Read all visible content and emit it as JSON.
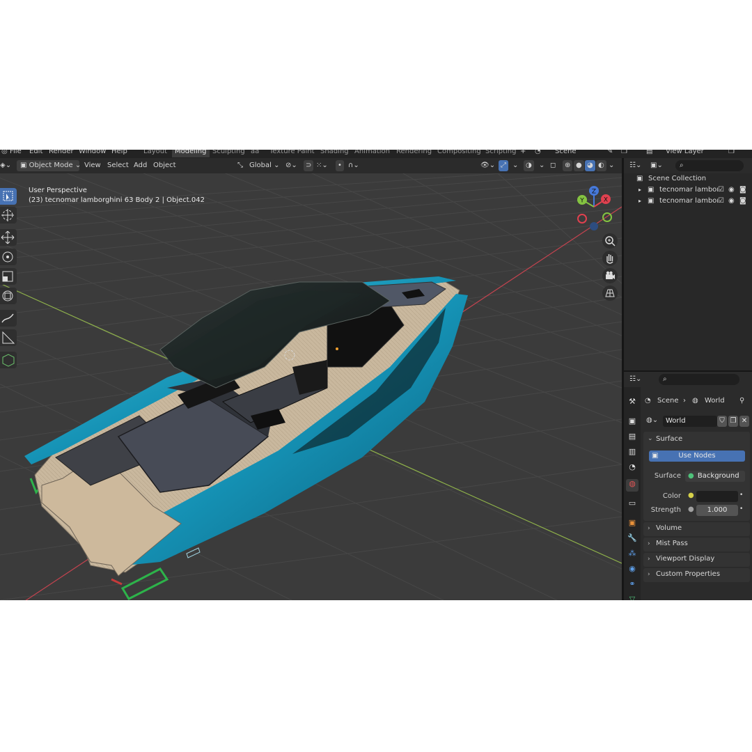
{
  "menu": {
    "items": [
      "File",
      "Edit",
      "Render",
      "Window",
      "Help"
    ],
    "workspaces": [
      "Layout",
      "Modeling",
      "Sculpting",
      "aa",
      "Texture Paint",
      "Shading",
      "Animation",
      "Rendering",
      "Compositing",
      "Scripting"
    ],
    "active_workspace": "Modeling",
    "scene_label": "Scene",
    "view_layer_label": "View Layer"
  },
  "viewport_header": {
    "mode": "Object Mode",
    "menus": [
      "View",
      "Select",
      "Add",
      "Object"
    ],
    "transform_orientation": "Global"
  },
  "viewport": {
    "perspective": "User Perspective",
    "object_info": "(23) tecnomar lamborghini 63 Body 2 | Object.042",
    "gizmo_axes": [
      "Z",
      "X",
      "Y"
    ]
  },
  "outliner": {
    "root": "Scene Collection",
    "items": [
      {
        "label": "tecnomar lamborgh"
      },
      {
        "label": "tecnomar lamborgh"
      }
    ]
  },
  "properties": {
    "breadcrumb": [
      "Scene",
      "World"
    ],
    "world_name": "World",
    "surface_panel": "Surface",
    "use_nodes_label": "Use Nodes",
    "surface_label": "Surface",
    "surface_value": "Background",
    "color_label": "Color",
    "strength_label": "Strength",
    "strength_value": "1.000",
    "panels": [
      "Volume",
      "Mist Pass",
      "Viewport Display",
      "Custom Properties"
    ]
  },
  "colors": {
    "accent": "#4772b3",
    "boat_hull": "#1aa7c9",
    "x_axis": "#e0414f",
    "y_axis": "#84c341",
    "z_axis": "#4679d9"
  }
}
